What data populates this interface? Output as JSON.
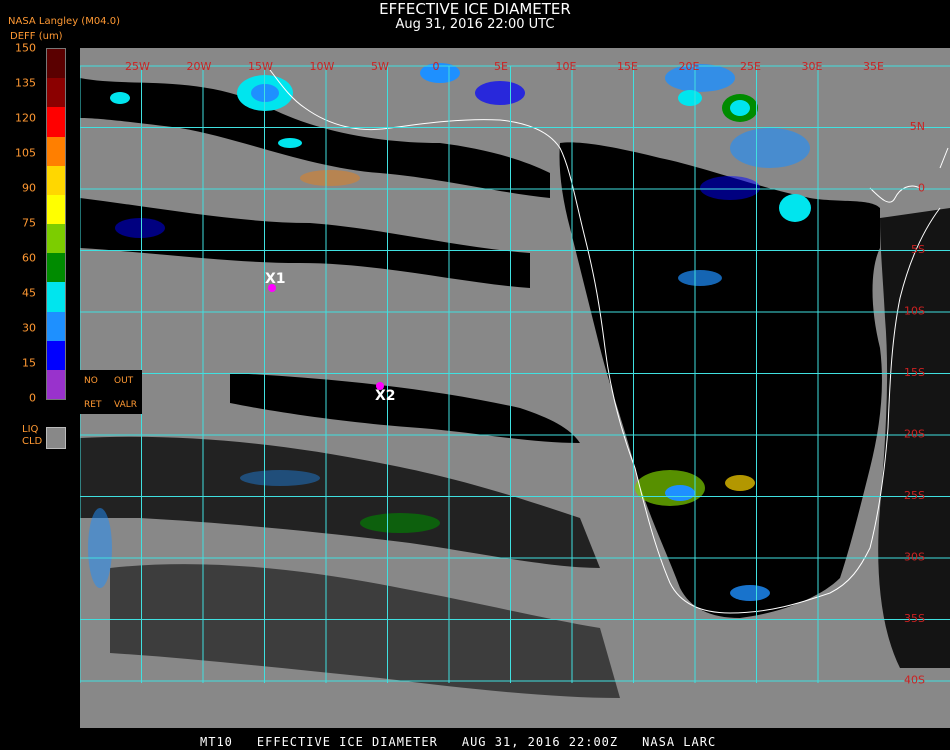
{
  "header": {
    "title": "EFFECTIVE ICE DIAMETER",
    "datetime": "Aug 31, 2016 22:00 UTC",
    "product_tag": "NASA Langley (M04.0)"
  },
  "legend": {
    "unit_label": "DEFF (um)",
    "ticks": [
      "150",
      "135",
      "120",
      "105",
      "90",
      "75",
      "60",
      "45",
      "30",
      "15",
      "0"
    ],
    "colors": [
      "#5a0000",
      "#8b0000",
      "#ff0000",
      "#ff7f00",
      "#ffd700",
      "#ffff00",
      "#7ccd00",
      "#008b00",
      "#00e5ee",
      "#1e90ff",
      "#0000ff",
      "#9932cc"
    ],
    "liquid_label_1": "LIQ",
    "liquid_label_2": "CLD",
    "liquid_color": "#888888",
    "noret_labels": {
      "no": "NO",
      "ret": "RET",
      "out": "OUT",
      "valr": "VALR"
    }
  },
  "map": {
    "lon_labels": [
      "25W",
      "20W",
      "15W",
      "10W",
      "5W",
      "0",
      "5E",
      "10E",
      "15E",
      "20E",
      "25E",
      "30E",
      "35E"
    ],
    "lat_labels": [
      "5N",
      "0",
      "5S",
      "10S",
      "15S",
      "20S",
      "25S",
      "30S",
      "35S",
      "40S"
    ],
    "markers": [
      {
        "label": "X1",
        "color": "#ff00ff"
      },
      {
        "label": "X2",
        "color": "#ff00ff"
      }
    ],
    "grid_color": "#40e0e0",
    "coast_color": "#ffffff",
    "cloud_free_color": "#000000",
    "liquid_cloud_color": "#888888",
    "label_color": "#cc2222"
  },
  "footer": {
    "satellite": "MT10",
    "product": "EFFECTIVE ICE DIAMETER",
    "time": "AUG 31, 2016 22:00Z",
    "org": "NASA LARC"
  }
}
